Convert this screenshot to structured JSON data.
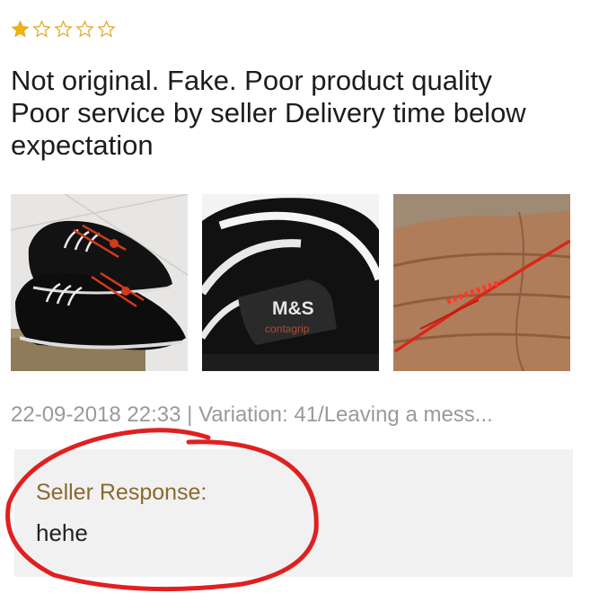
{
  "rating": {
    "value": 1,
    "max": 5,
    "filled_color": "#f4b400",
    "empty_color": "#e0a82c"
  },
  "review": {
    "lines": [
      "Not original. Fake. Poor product quality",
      "Poor service by seller  Delivery time below",
      "expectation"
    ]
  },
  "photos": [
    {
      "name": "shoes-photo"
    },
    {
      "name": "shoe-closeup-photo",
      "brand": "M&S",
      "subbrand": "contagrip"
    },
    {
      "name": "red-thread-photo"
    }
  ],
  "meta": {
    "text": "22-09-2018 22:33 | Variation: 41/Leaving a mess..."
  },
  "seller_response": {
    "label": "Seller Response:",
    "text": "hehe"
  },
  "annotation": {
    "color": "#e02020"
  }
}
